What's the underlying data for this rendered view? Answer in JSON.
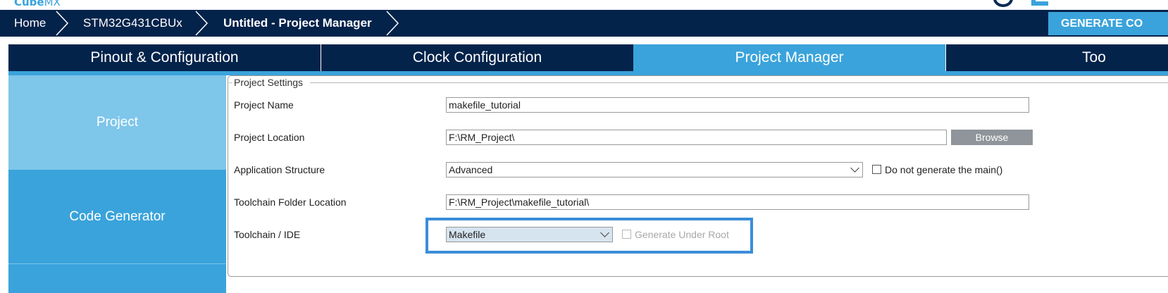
{
  "app": {
    "logo_text": "Cube",
    "logo_text_suffix": "MX"
  },
  "breadcrumb": {
    "items": [
      "Home",
      "STM32G431CBUx",
      "Untitled - Project Manager"
    ]
  },
  "generate_button_label": "GENERATE CO",
  "tabs": [
    "Pinout & Configuration",
    "Clock Configuration",
    "Project Manager",
    "Too"
  ],
  "active_tab": "Project Manager",
  "sidenav": {
    "items": [
      "Project",
      "Code Generator"
    ],
    "active": "Project"
  },
  "project_settings": {
    "legend": "Project Settings",
    "project_name_label": "Project Name",
    "project_name_value": "makefile_tutorial",
    "project_location_label": "Project Location",
    "project_location_value": "F:\\RM_Project\\",
    "browse_label": "Browse",
    "app_structure_label": "Application Structure",
    "app_structure_value": "Advanced",
    "do_not_generate_main_label": "Do not generate the main()",
    "do_not_generate_main_checked": false,
    "toolchain_folder_label": "Toolchain Folder Location",
    "toolchain_folder_value": "F:\\RM_Project\\makefile_tutorial\\",
    "toolchain_ide_label": "Toolchain / IDE",
    "toolchain_ide_value": "Makefile",
    "generate_under_root_label": "Generate Under Root",
    "generate_under_root_checked": false,
    "generate_under_root_enabled": false
  },
  "colors": {
    "nav_dark": "#03234b",
    "accent": "#3aa3db",
    "side_active": "#7ec6ea",
    "highlight": "#3a8ed8",
    "button_gray": "#8f959a"
  }
}
